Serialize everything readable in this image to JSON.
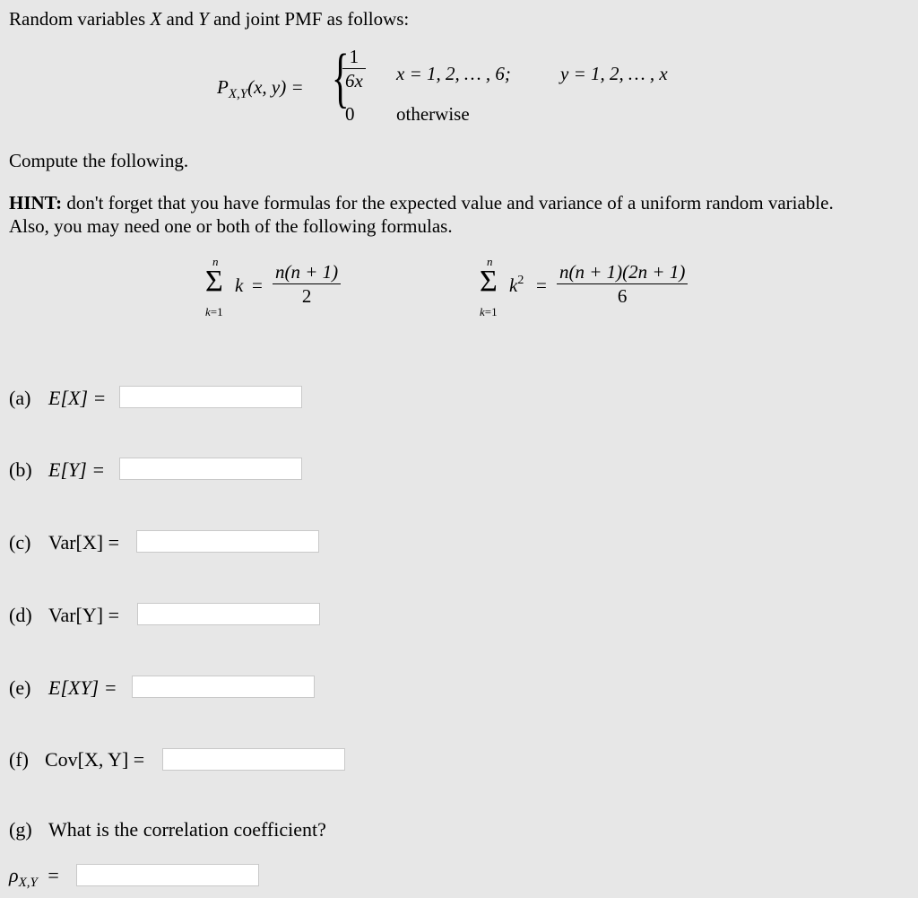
{
  "intro": {
    "prefix": "Random variables ",
    "var_x": "X",
    "and1": " and ",
    "var_y": "Y",
    "suffix": " and joint PMF as follows:"
  },
  "pmf": {
    "lhs_p": "P",
    "lhs_sub": "X,Y",
    "lhs_args": "(x, y) =",
    "case1_num": "1",
    "case1_den": "6x",
    "case1_cond_x": "x = 1, 2,  … , 6;",
    "case1_cond_y": "y = 1, 2,  … , x",
    "case2_value": "0",
    "case2_cond": "otherwise"
  },
  "compute_text": "Compute the following.",
  "hint": {
    "label": "HINT:",
    "line1": " don't forget that you have formulas for the expected value and variance of a uniform random variable.",
    "line2": "Also, you may need one or both of the following formulas."
  },
  "formulas": [
    {
      "upper": "n",
      "lower": "k=1",
      "term": "k",
      "term_sup": "",
      "equals": "=",
      "numerator": "n(n + 1)",
      "denominator": "2"
    },
    {
      "upper": "n",
      "lower": "k=1",
      "term": "k",
      "term_sup": "2",
      "equals": "=",
      "numerator": "n(n + 1)(2n + 1)",
      "denominator": "6"
    }
  ],
  "questions": [
    {
      "letter": "(a)",
      "expr": "E[X] =",
      "value": "",
      "placeholder": ""
    },
    {
      "letter": "(b)",
      "expr": "E[Y] =",
      "value": "",
      "placeholder": ""
    },
    {
      "letter": "(c)",
      "expr": "Var[X] =",
      "value": "",
      "placeholder": ""
    },
    {
      "letter": "(d)",
      "expr": "Var[Y] =",
      "value": "",
      "placeholder": ""
    },
    {
      "letter": "(e)",
      "expr": "E[XY] =",
      "value": "",
      "placeholder": ""
    },
    {
      "letter": "(f)",
      "expr": "Cov[X, Y] =",
      "value": "",
      "placeholder": ""
    }
  ],
  "question_g": {
    "letter": "(g)",
    "text": "What is the correlation coefficient?",
    "rho": "ρ",
    "rho_sub": "X,Y",
    "equals": "=",
    "value": "",
    "placeholder": ""
  }
}
